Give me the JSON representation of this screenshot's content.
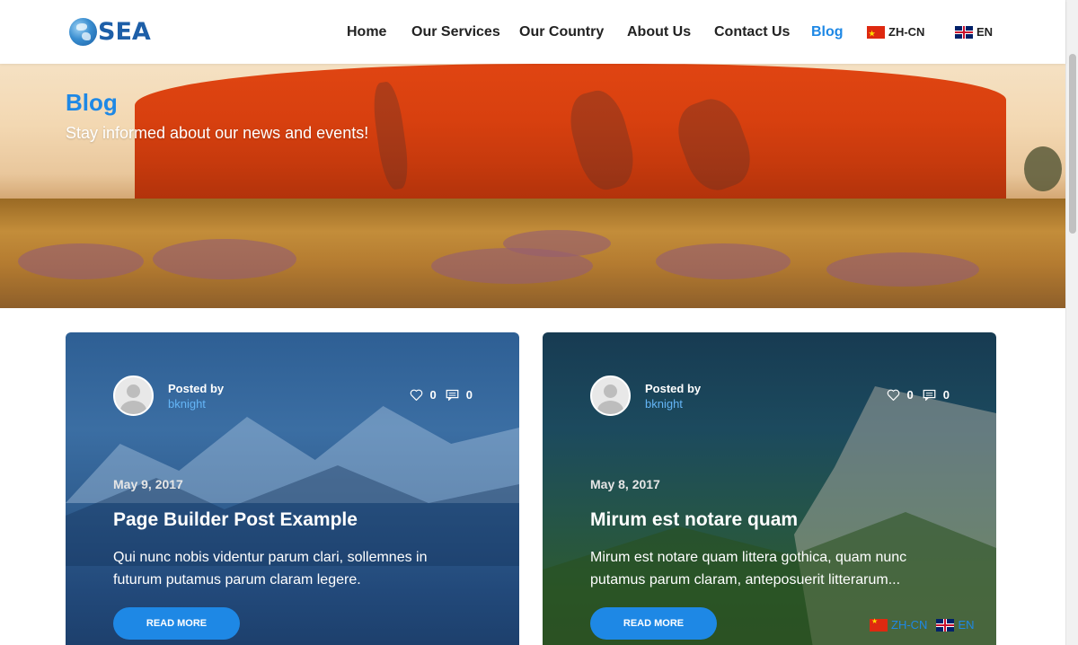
{
  "logo": {
    "text": "SEA"
  },
  "nav": {
    "items": [
      {
        "label": "Home",
        "active": false
      },
      {
        "label": "Our Services",
        "active": false
      },
      {
        "label": "Our Country",
        "active": false
      },
      {
        "label": "About Us",
        "active": false
      },
      {
        "label": "Contact Us",
        "active": false
      },
      {
        "label": "Blog",
        "active": true
      }
    ],
    "languages": [
      {
        "label": "ZH-CN",
        "flag": "china-flag-icon"
      },
      {
        "label": "EN",
        "flag": "uk-flag-icon"
      }
    ]
  },
  "hero": {
    "title": "Blog",
    "subtitle": "Stay informed about our news and events!"
  },
  "posts": [
    {
      "posted_by_label": "Posted by",
      "author": "bknight",
      "likes": "0",
      "comments": "0",
      "date": "May 9, 2017",
      "title": "Page Builder Post Example",
      "excerpt": "Qui nunc nobis videntur parum clari, sollemnes in futurum putamus parum claram legere.",
      "button": "READ MORE"
    },
    {
      "posted_by_label": "Posted by",
      "author": "bknight",
      "likes": "0",
      "comments": "0",
      "date": "May 8, 2017",
      "title": "Mirum est notare quam",
      "excerpt": "Mirum est notare quam littera gothica, quam nunc putamus parum claram, anteposuerit litterarum...",
      "button": "READ MORE"
    }
  ],
  "footer_languages": [
    {
      "label": "ZH-CN"
    },
    {
      "label": "EN"
    }
  ],
  "colors": {
    "accent": "#1e88e5",
    "nav_text": "#222222",
    "author_link": "#64b5f6"
  }
}
